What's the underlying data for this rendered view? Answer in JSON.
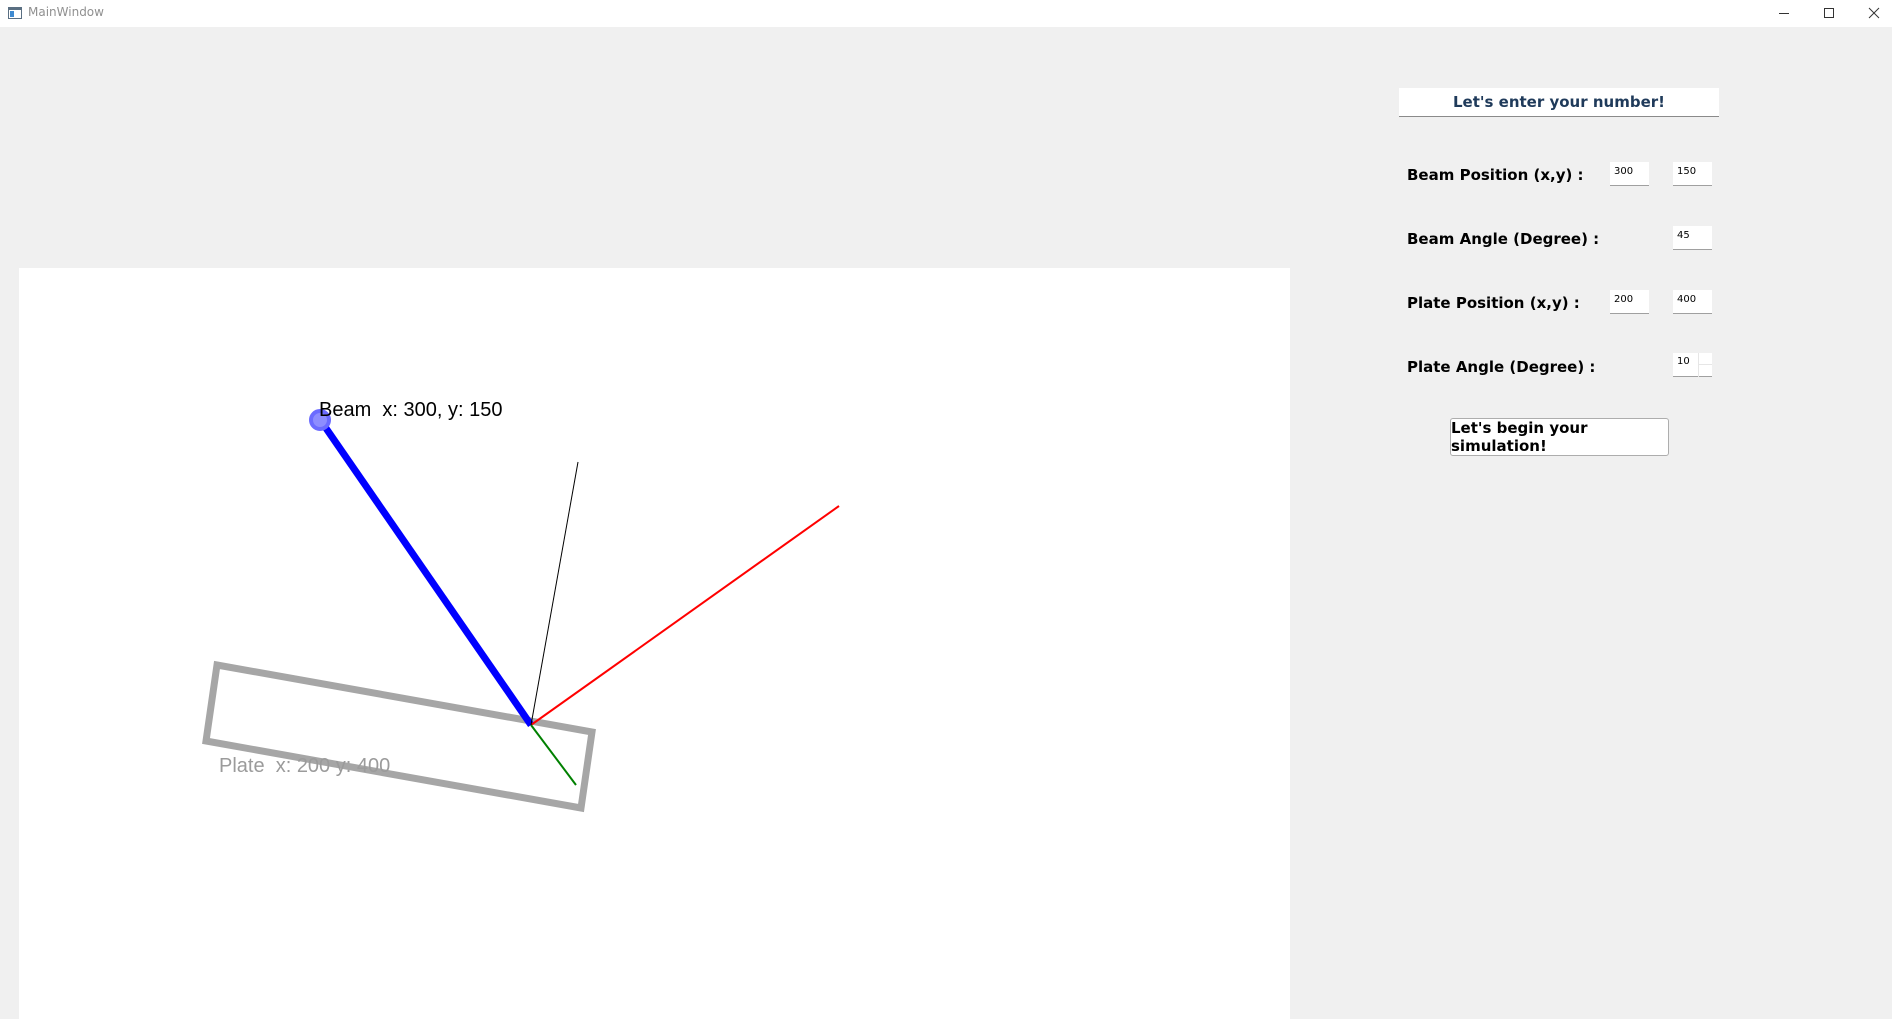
{
  "window": {
    "title": "MainWindow"
  },
  "colors": {
    "beam": "#0000ff",
    "beam_marker": "#6b6bff",
    "plate": "#a6a6a6",
    "axis_red": "#ff0000",
    "axis_green": "#008000",
    "axis_black": "#000000",
    "header_text": "#1f3a5a"
  },
  "scene": {
    "beam_label": "Beam  x: 300, y: 150",
    "plate_label": "Plate  x: 200 y: 400"
  },
  "form": {
    "header": "Let's enter your number!",
    "beam_position_label": "Beam Position (x,y) :",
    "beam_x": "300",
    "beam_y": "150",
    "beam_angle_label": "Beam Angle (Degree) :",
    "beam_angle": "45",
    "plate_position_label": "Plate Position (x,y) :",
    "plate_x": "200",
    "plate_y": "400",
    "plate_angle_label": "Plate Angle (Degree) :",
    "plate_angle": "10",
    "simulate_button": "Let's begin your simulation!"
  },
  "icons": {
    "app": "app-window-icon",
    "minimize": "minimize-icon",
    "maximize": "maximize-icon",
    "close": "close-icon"
  }
}
